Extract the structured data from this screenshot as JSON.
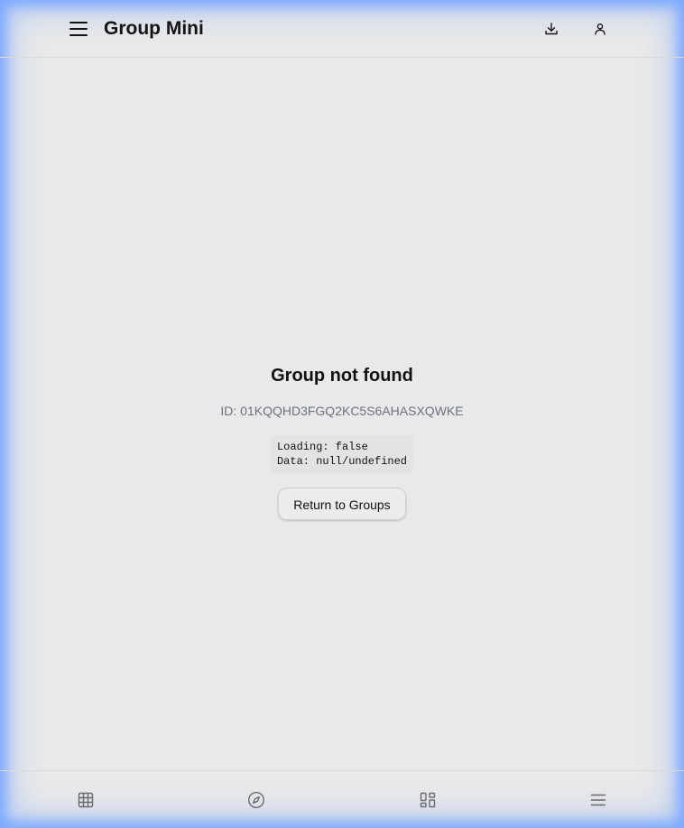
{
  "header": {
    "title": "Group Mini",
    "menu_icon": "hamburger-menu-icon",
    "actions": [
      {
        "name": "download-icon"
      },
      {
        "name": "user-icon"
      }
    ]
  },
  "main": {
    "title": "Group not found",
    "id_line": "ID: 01KQQHD3FGQ2KC5S6AHASXQWKE",
    "debug": {
      "loading": "Loading: false",
      "data": "Data: null/undefined"
    },
    "return_label": "Return to Groups"
  },
  "bottom_nav": {
    "items": [
      {
        "icon": "grid-table-icon"
      },
      {
        "icon": "compass-icon"
      },
      {
        "icon": "dashboard-icon"
      },
      {
        "icon": "list-menu-icon"
      }
    ]
  },
  "colors": {
    "background": "#e9e9e9",
    "title": "#141414",
    "muted": "#6b7280",
    "border": "#d8d8d8",
    "glow": "#7aa8ff"
  }
}
